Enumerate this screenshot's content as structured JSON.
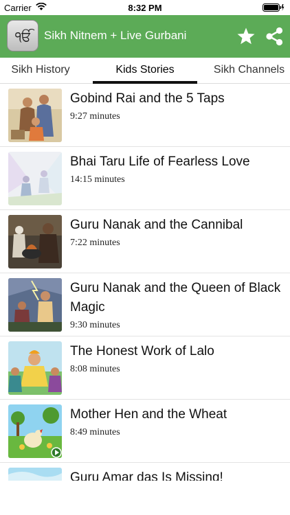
{
  "status_bar": {
    "carrier": "Carrier",
    "time": "8:32 PM"
  },
  "app_bar": {
    "title": "Sikh Nitnem + Live Gurbani",
    "background_color": "#5cab57",
    "star_icon": "star-icon",
    "share_icon": "share-icon"
  },
  "tabs": [
    {
      "label": "Sikh History",
      "selected": false
    },
    {
      "label": "Kids Stories",
      "selected": true
    },
    {
      "label": "Sikh Channels",
      "selected": false
    }
  ],
  "stories": [
    {
      "title": "Gobind Rai and the 5 Taps",
      "duration": "9:27 minutes"
    },
    {
      "title": "Bhai Taru Life of Fearless Love",
      "duration": "14:15 minutes"
    },
    {
      "title": "Guru Nanak and the Cannibal",
      "duration": "7:22 minutes"
    },
    {
      "title": "Guru Nanak and the Queen of Black Magic",
      "duration": "9:30 minutes"
    },
    {
      "title": "The Honest Work of Lalo",
      "duration": "8:08 minutes"
    },
    {
      "title": "Mother Hen and the Wheat",
      "duration": "8:49 minutes"
    },
    {
      "title": "Guru Amar das Is Missing!",
      "duration": ""
    }
  ]
}
